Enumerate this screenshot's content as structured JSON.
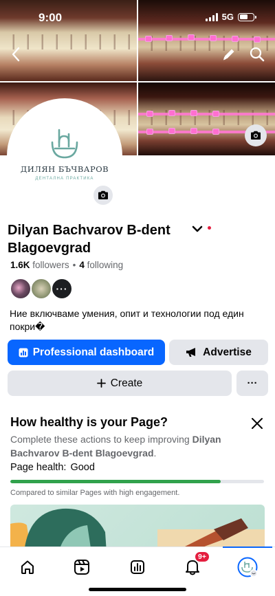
{
  "status_bar": {
    "time": "9:00",
    "network": "5G"
  },
  "page": {
    "name": "Dilyan Bachvarov B-dent Blagoevgrad",
    "followers_count": "1.6K",
    "followers_label": "followers",
    "separator": "•",
    "following_count": "4",
    "following_label": "following",
    "bio": "Ние включваме умения, опит и технологии под един покри�"
  },
  "logo": {
    "text": "ДИЛЯН БЪЧВАРОВ",
    "subtext": "ДЕНТАЛНА ПРАКТИКА",
    "color": "#6aa8a0"
  },
  "friends": {
    "more_label": "···"
  },
  "buttons": {
    "professional_dashboard": "Professional dashboard",
    "advertise": "Advertise",
    "create": "Create",
    "more": "···"
  },
  "health_card": {
    "title": "How healthy is your Page?",
    "desc_prefix": "Complete these actions to keep improving ",
    "desc_page_name": "Dilyan Bachvarov B-dent Blagoevgrad",
    "desc_suffix": ".",
    "status_label": "Page health:",
    "status_value": "Good",
    "progress_fraction": 0.83,
    "note": "Compared to similar Pages with high engagement."
  },
  "bottom_nav": {
    "notifications_badge": "9+",
    "items": [
      "home-icon",
      "video-icon",
      "dashboard-icon",
      "bell-icon",
      "profile-avatar"
    ]
  },
  "colors": {
    "primary": "#0866ff",
    "secondary_bg": "#e4e6eb",
    "health_good": "#31a24c",
    "badge": "#e41e3f"
  }
}
